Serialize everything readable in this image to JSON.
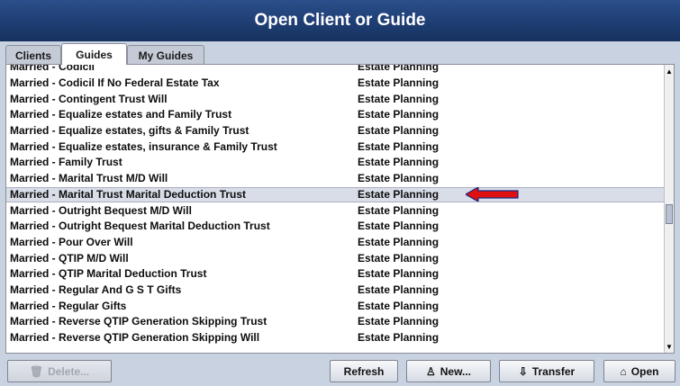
{
  "window": {
    "title": "Open Client or Guide"
  },
  "tabs": [
    {
      "label": "Clients"
    },
    {
      "label": "Guides"
    },
    {
      "label": "My Guides"
    }
  ],
  "list": {
    "partial_top_row": {
      "name": "Married - Codicil",
      "type": "Estate Planning"
    },
    "rows": [
      {
        "name": "Married - Codicil If No Federal Estate Tax",
        "type": "Estate Planning"
      },
      {
        "name": "Married - Contingent Trust Will",
        "type": "Estate Planning"
      },
      {
        "name": "Married - Equalize estates and Family Trust",
        "type": "Estate Planning"
      },
      {
        "name": "Married - Equalize estates, gifts & Family Trust",
        "type": "Estate Planning"
      },
      {
        "name": "Married - Equalize estates, insurance & Family Trust",
        "type": "Estate Planning"
      },
      {
        "name": "Married - Family Trust",
        "type": "Estate Planning"
      },
      {
        "name": "Married - Marital Trust M/D Will",
        "type": "Estate Planning"
      },
      {
        "name": "Married - Marital Trust Marital Deduction Trust",
        "type": "Estate Planning"
      },
      {
        "name": "Married - Outright Bequest M/D Will",
        "type": "Estate Planning"
      },
      {
        "name": "Married - Outright Bequest Marital Deduction Trust",
        "type": "Estate Planning"
      },
      {
        "name": "Married - Pour Over Will",
        "type": "Estate Planning"
      },
      {
        "name": "Married - QTIP M/D Will",
        "type": "Estate Planning"
      },
      {
        "name": "Married - QTIP Marital Deduction Trust",
        "type": "Estate Planning"
      },
      {
        "name": "Married - Regular And G S T Gifts",
        "type": "Estate Planning"
      },
      {
        "name": "Married - Regular Gifts",
        "type": "Estate Planning"
      },
      {
        "name": "Married - Reverse QTIP Generation Skipping Trust",
        "type": "Estate Planning"
      },
      {
        "name": "Married - Reverse QTIP Generation Skipping Will",
        "type": "Estate Planning"
      }
    ],
    "selected_index": 7
  },
  "buttons": {
    "delete": "Delete...",
    "refresh": "Refresh",
    "new": "New...",
    "transfer": "Transfer",
    "open": "Open"
  },
  "icons": {
    "delete": "trash-icon",
    "new": "new-guide-icon",
    "transfer": "transfer-icon",
    "open": "open-folder-icon",
    "annotation": "red-arrow-icon"
  },
  "colors": {
    "title_bar": "#1f3f76",
    "selected_row": "#d9dde8",
    "annotation_arrow": "#e01010"
  }
}
